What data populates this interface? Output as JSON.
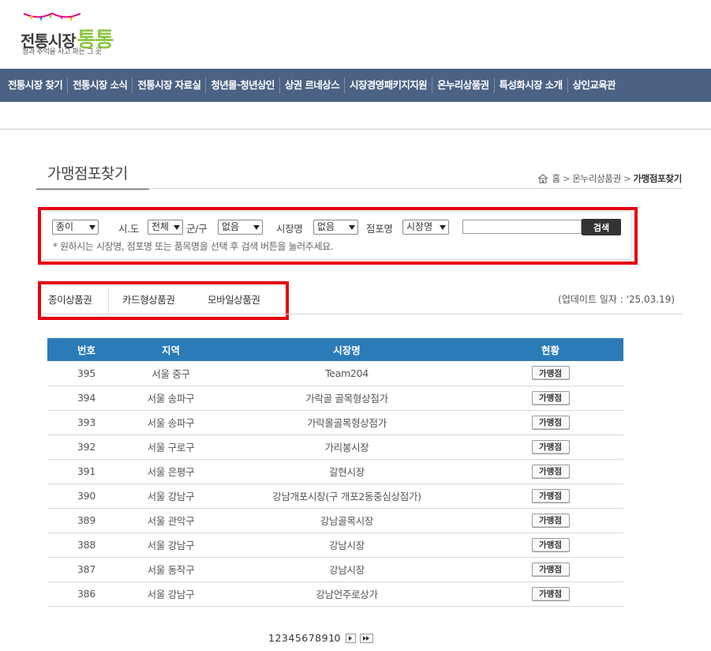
{
  "logo": {
    "brand_text": "전통시장",
    "brand_highlight": "통통",
    "tagline": "정과 추억을 사고 파는 그 곳"
  },
  "nav": {
    "items": [
      "전통시장 찾기",
      "전통시장 소식",
      "전통시장 자료실",
      "청년몰·청년상인",
      "상권 르네상스",
      "시장경영패키지지원",
      "온누리상품권",
      "특성화시장 소개",
      "상인교육관"
    ]
  },
  "page": {
    "title": "가맹점포찾기",
    "breadcrumb": {
      "home": "홈",
      "sep": ">",
      "level1": "온누리상품권",
      "current": "가맹점포찾기"
    }
  },
  "search": {
    "type_value": "종이",
    "sido_label": "시.도",
    "sido_value": "전체",
    "gungu_label": "군/구",
    "gungu_value": "없음",
    "market_label": "시장명",
    "market_value": "없음",
    "store_label": "점포명",
    "field_value": "시장명",
    "keyword_value": "",
    "button_label": "검색",
    "hint": "* 원하시는 시장명, 점포명 또는 품목명을 선택 후 검색 버튼을 눌러주세요."
  },
  "tabs": {
    "items": [
      "종이상품권",
      "카드형상품권",
      "모바일상품권"
    ],
    "update": "(업데이트 일자 : '25.03.19)"
  },
  "table": {
    "headers": [
      "번호",
      "지역",
      "시장명",
      "현황"
    ],
    "button_label": "가맹점",
    "rows": [
      {
        "no": "395",
        "region": "서울 중구",
        "name": "Team204"
      },
      {
        "no": "394",
        "region": "서울 송파구",
        "name": "가락골 골목형상점가"
      },
      {
        "no": "393",
        "region": "서울 송파구",
        "name": "가락몰골목형상점가"
      },
      {
        "no": "392",
        "region": "서울 구로구",
        "name": "가리봉시장"
      },
      {
        "no": "391",
        "region": "서울 은평구",
        "name": "갈현시장"
      },
      {
        "no": "390",
        "region": "서울 강남구",
        "name": "강남개포시장(구 개포2동중심상점가)"
      },
      {
        "no": "389",
        "region": "서울 관악구",
        "name": "강남골목시장"
      },
      {
        "no": "388",
        "region": "서울 강남구",
        "name": "강남시장"
      },
      {
        "no": "387",
        "region": "서울 동작구",
        "name": "강남시장"
      },
      {
        "no": "386",
        "region": "서울 강남구",
        "name": "강남언주로상가"
      }
    ]
  },
  "pagination": {
    "pages": [
      "1",
      "2",
      "3",
      "4",
      "5",
      "6",
      "7",
      "8",
      "9",
      "10"
    ]
  },
  "colors": {
    "nav_bg": "#4c6284",
    "table_header_bg": "#2b7bb9",
    "highlight_border": "#e60012"
  }
}
